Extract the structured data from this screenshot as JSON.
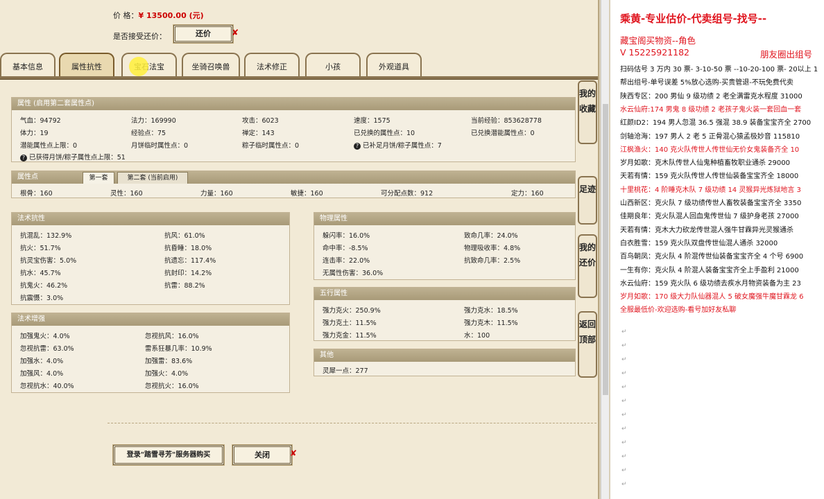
{
  "top": {
    "price_label": "价        格：",
    "price_value": "¥ 13500.00 (元)",
    "bargain_label": "是否接受还价：",
    "bargain_button": "还价"
  },
  "tabs": [
    "基本信息",
    "属性抗性",
    "宝石法宝",
    "坐骑召唤兽",
    "法术修正",
    "小孩",
    "外观道具"
  ],
  "attr": {
    "header": "属性 (启用第二套属性点)",
    "rows": [
      [
        "气血：94792",
        "法力：169990",
        "攻击：6023",
        "速度：1575",
        "当前经验：853628778"
      ],
      [
        "体力：19",
        "经验点：75",
        "禅定：143",
        "已兑换的属性点：10",
        "已兑换潜能属性点：0"
      ],
      [
        "潜能属性点上限：0",
        "月饼临时属性点：0",
        "粽子临时属性点：0",
        "已补足月饼/粽子属性点：7"
      ]
    ],
    "note": "已获得月饼/粽子属性点上限：51"
  },
  "points": {
    "header": "属性点",
    "subtab1": "第一套",
    "subtab2": "第二套 (当前启用)",
    "values": [
      "根骨：160",
      "灵性：160",
      "力量：160",
      "敏捷：160",
      "可分配点数：912",
      "定力：160"
    ]
  },
  "resist": {
    "header": "法术抗性",
    "left": [
      "抗混乱：132.9%",
      "抗火：51.7%",
      "抗灵宝伤害：5.0%",
      "抗水：45.7%",
      "抗鬼火：46.2%",
      "抗震慑：3.0%"
    ],
    "right": [
      "抗风：61.0%",
      "抗昏睡：18.0%",
      "抗遗忘：117.4%",
      "抗封印：14.2%",
      "抗雷：88.2%"
    ]
  },
  "enhance": {
    "header": "法术增强",
    "left": [
      "加强鬼火：4.0%",
      "忽视抗雷：63.0%",
      "加强水：4.0%",
      "加强风：4.0%",
      "忽视抗水：40.0%"
    ],
    "right": [
      "忽视抗风：16.0%",
      "雷系狂暴几率：10.9%",
      "加强雷：83.6%",
      "加强火：4.0%",
      "忽视抗火：16.0%"
    ]
  },
  "physical": {
    "header": "物理属性",
    "left": [
      "躲闪率：16.0%",
      "命中率：-8.5%",
      "连击率：22.0%",
      "无属性伤害：36.0%"
    ],
    "right": [
      "致命几率：24.0%",
      "物理吸收率：4.8%",
      "抗致命几率：2.5%"
    ]
  },
  "wuxing": {
    "header": "五行属性",
    "left": [
      "强力克火：250.9%",
      "强力克土：11.5%",
      "强力克金：11.5%"
    ],
    "right": [
      "强力克水：18.5%",
      "强力克木：11.5%",
      "水：100"
    ]
  },
  "other": {
    "header": "其他",
    "rows": [
      "灵犀一点：277"
    ]
  },
  "side": {
    "favorites": "我的收藏",
    "footprints": "足迹",
    "my_bargains": "我的还价",
    "back_top": "返回顶部"
  },
  "bottom": {
    "login_button": "登录\"踏雪寻芳\"服务器购买",
    "close_button": "关闭"
  },
  "doc": {
    "title": "乘黄-专业估价-代卖组号-找号--",
    "line1": "藏宝阁买物资--角色",
    "line2": "V 15225921182",
    "line2b": "朋友圈出组号",
    "lines": [
      [
        "扫码估号 3 万内 30 票- 3-10-50 票  --10-20-100 票- 20以上 1",
        false
      ],
      [
        "帮出组号-单号误差 5%放心选购-买贵管退-不玩免费代卖",
        false
      ],
      [
        "陕西专区：200 男仙 9 级功绩 2 老全满雷克水程度 31000",
        false
      ],
      [
        "水云仙府:174 男鬼 8 级功绩 2 老孩子鬼火装一套回血一套",
        true
      ],
      [
        "红颜ID2：194 男人忽混 36.5 强混 38.9 装备宝宝齐全 2700",
        false
      ],
      [
        "剑轴沧海：197 男人 2 老 5 正骨混心猿孟极妙音 115810",
        false
      ],
      [
        "江枫渔火：140 克火队传世人传世仙无价女鬼装备齐全 10",
        true
      ],
      [
        "岁月如歌：克木队传世人仙鬼种植畜牧职业通杀 29000",
        false
      ],
      [
        "天若有情：159 克火队传世人传世仙装备宝宝齐全 18000",
        false
      ],
      [
        "十里桃花：4 阶睡克木队 7 级功绩 14 灵猴异光炼狱地言 3",
        true
      ],
      [
        "山西新区：克火队 7 级功绩传世人畜牧装备宝宝齐全 3350",
        false
      ],
      [
        "佳期良年：克火队混人回血鬼传世仙 7 级护身老孩 27000",
        false
      ],
      [
        "天若有情：克木大力砍龙传世混人强牛甘霖异光灵猴通杀",
        false
      ],
      [
        "白衣胜雪：159 克火队双盘传世仙混人通杀 32000",
        false
      ],
      [
        "百鸟朝凤：克火队 4 阶混传世仙装备宝宝齐全 4 个号 6900",
        false
      ],
      [
        "一生有你：克火队 4 阶混人装备宝宝齐全上手盈利 21000",
        false
      ],
      [
        "水云仙府：159 克火队 6 级功绩去疾水月物资装备为主 23",
        false
      ],
      [
        "岁月如歌：170 级大力队仙器混人 5 破女魔强牛魔甘霖龙 6",
        true
      ],
      [
        "全服最低价-欢迎选购-看号加好友私聊",
        true
      ]
    ],
    "para_mark": "↵"
  }
}
